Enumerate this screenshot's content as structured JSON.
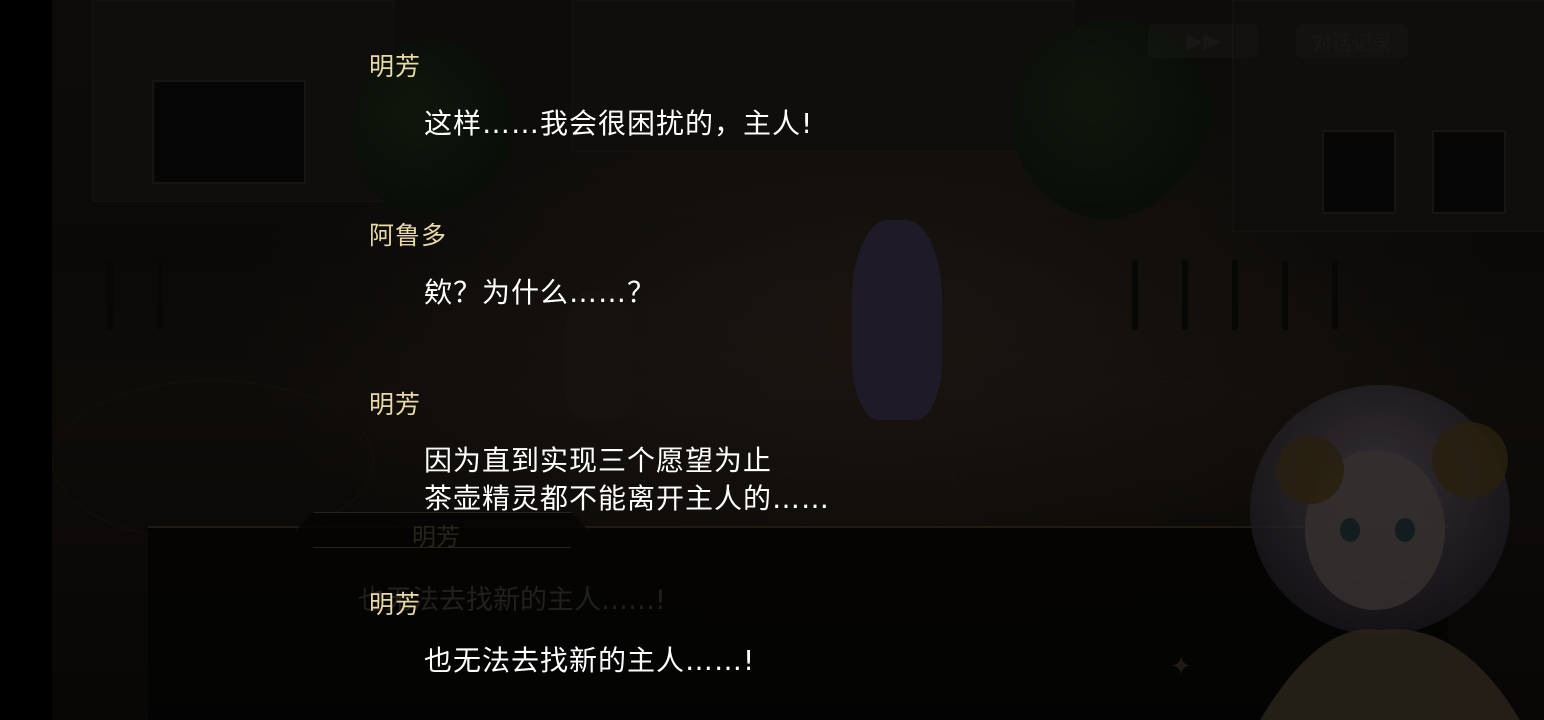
{
  "hud": {
    "skip_label": "▶▶",
    "log_label": "对话记录"
  },
  "dialogue_box": {
    "speaker": "明芳",
    "text": "也无法去找新的主人……!"
  },
  "log": {
    "entries": [
      {
        "speaker": "明芳",
        "lines": [
          "这样……我会很困扰的，主人!"
        ]
      },
      {
        "speaker": "阿鲁多",
        "lines": [
          "欸？为什么……？"
        ]
      },
      {
        "speaker": "明芳",
        "lines": [
          "因为直到实现三个愿望为止",
          "茶壶精灵都不能离开主人的……"
        ]
      },
      {
        "speaker": "明芳",
        "lines": [
          "也无法去找新的主人……!"
        ]
      }
    ]
  },
  "colors": {
    "speaker": "#e9d9a4",
    "line_text": "#ffffff",
    "overlay": "rgba(0,0,0,0.45)"
  },
  "icons": {
    "emblem": "emblem-icon",
    "skip": "fast-forward-icon"
  }
}
